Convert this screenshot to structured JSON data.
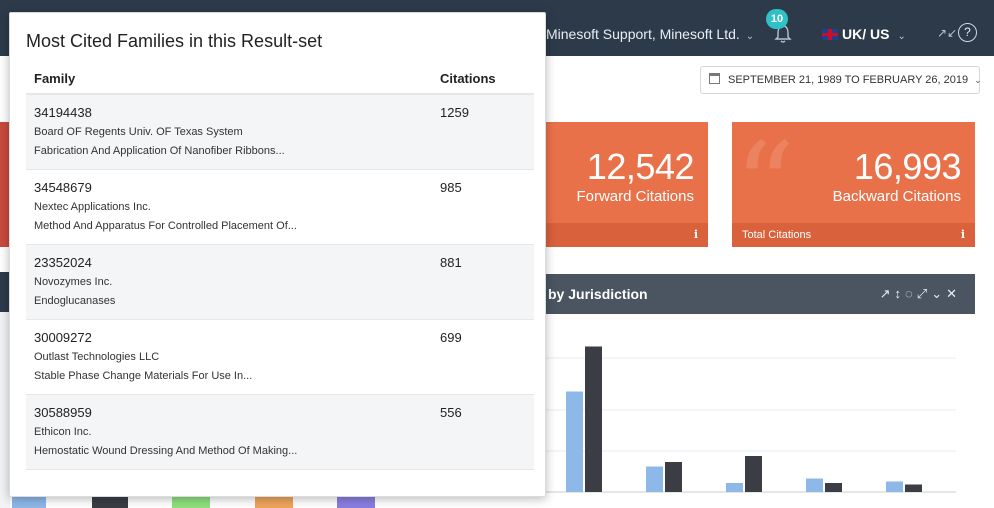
{
  "topbar": {
    "user_label": "Minesoft Support, Minesoft Ltd.",
    "notification_count": "10",
    "language_label": "UK/ US"
  },
  "date_range": "SEPTEMBER 21, 1989 TO FEBRUARY 26, 2019",
  "stats": [
    {
      "value": "12,542",
      "label": "Forward Citations",
      "footer": ""
    },
    {
      "value": "16,993",
      "label": "Backward Citations",
      "footer": "Total Citations"
    }
  ],
  "chart_panel": {
    "title": "by Jurisdiction"
  },
  "chart_data": {
    "type": "bar",
    "categories": [
      "",
      "",
      "",
      "",
      ""
    ],
    "series": [
      {
        "values": [
          67,
          17,
          6,
          9,
          7
        ]
      },
      {
        "values": [
          97,
          20,
          24,
          6,
          5
        ]
      }
    ],
    "colors": [
      "#8db8e8",
      "#3a3e44"
    ]
  },
  "popover": {
    "title": "Most Cited Families in this Result-set",
    "columns": {
      "family": "Family",
      "citations": "Citations"
    },
    "rows": [
      {
        "family": "34194438",
        "owner": "Board OF Regents Univ. OF Texas System",
        "title": "Fabrication And Application Of Nanofiber Ribbons...",
        "citations": "1259"
      },
      {
        "family": "34548679",
        "owner": "Nextec Applications Inc.",
        "title": "Method And Apparatus For Controlled Placement Of...",
        "citations": "985"
      },
      {
        "family": "23352024",
        "owner": "Novozymes Inc.",
        "title": "Endoglucanases",
        "citations": "881"
      },
      {
        "family": "30009272",
        "owner": "Outlast Technologies LLC",
        "title": "Stable Phase Change Materials For Use In...",
        "citations": "699"
      },
      {
        "family": "30588959",
        "owner": "Ethicon Inc.",
        "title": "Hemostatic Wound Dressing And Method Of Making...",
        "citations": "556"
      }
    ]
  },
  "icons": {
    "bell": "bell-icon",
    "calendar": "calendar-icon",
    "help": "help-icon",
    "expand": "fullscreen-icon",
    "info": "info-icon"
  }
}
